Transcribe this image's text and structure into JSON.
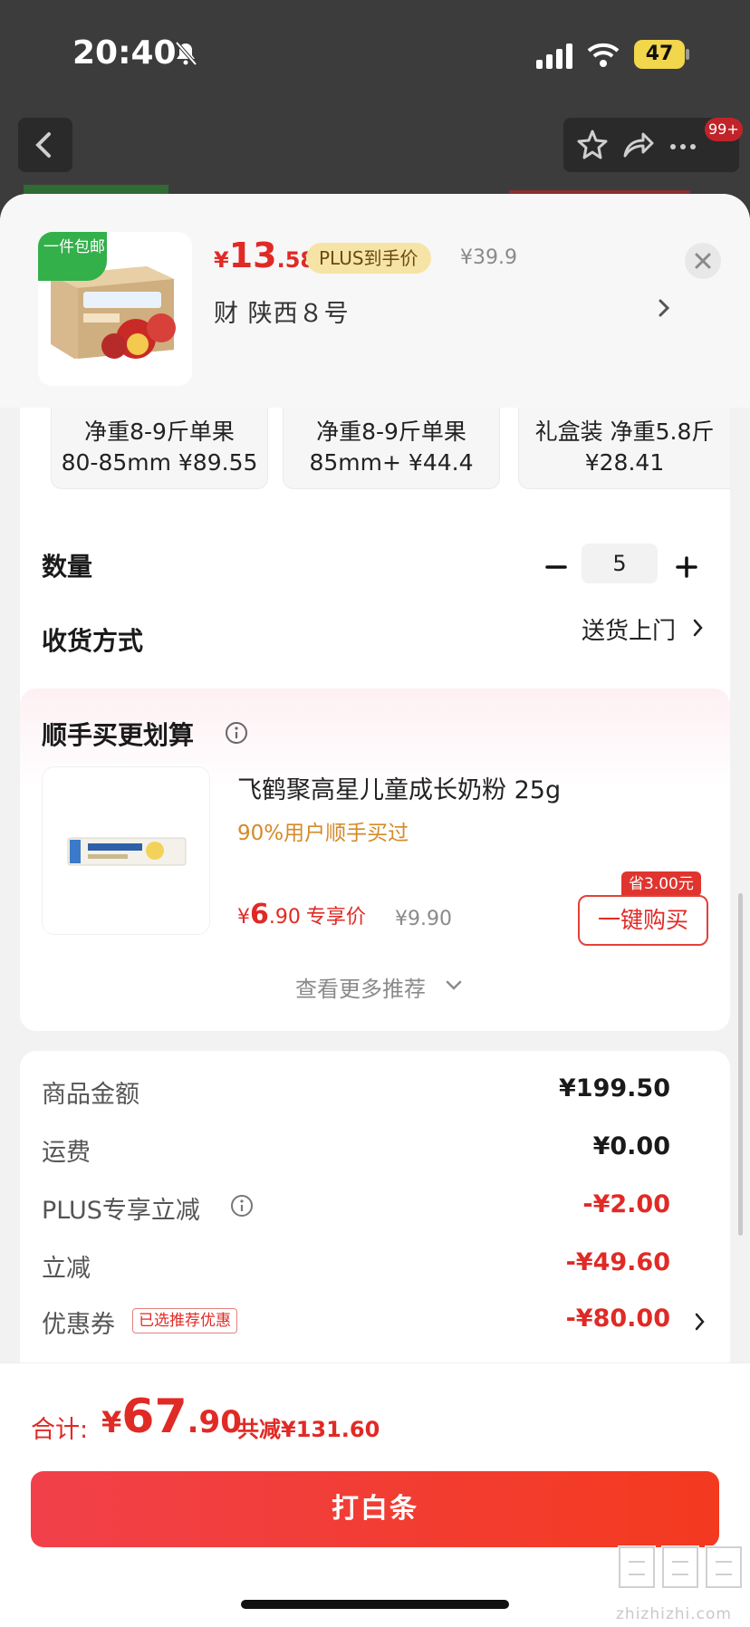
{
  "status_bar": {
    "time": "20:40",
    "battery": "47"
  },
  "background": {
    "notification_badge": "99+"
  },
  "header": {
    "shipping_tag": "一件包邮",
    "price_symbol": "¥",
    "price_int": "13",
    "price_dec": ".58",
    "plus_tag": "PLUS到手价",
    "original_price": "¥39.9",
    "selected_variant": "财  陕西８号"
  },
  "specs": [
    {
      "line1": "净重8-9斤单果",
      "line2": "80-85mm ¥89.55"
    },
    {
      "line1": "净重8-9斤单果",
      "line2": "85mm+ ¥44.4"
    },
    {
      "line1": "礼盒装 净重5.8斤",
      "line2": "¥28.41"
    }
  ],
  "quantity": {
    "label": "数量",
    "value": "5"
  },
  "delivery": {
    "label": "收货方式",
    "value": "送货上门"
  },
  "recommend": {
    "title": "顺手买更划算",
    "item_name": "飞鹤聚高星儿童成长奶粉 25g",
    "item_sub": "90%用户顺手买过",
    "price_symbol": "¥",
    "price_int": "6",
    "price_dec": ".90",
    "price_label": "专享价",
    "original_price": "¥9.90",
    "save_badge": "省3.00元",
    "buy_button": "一键购买",
    "more_link": "查看更多推荐"
  },
  "summary": {
    "rows": [
      {
        "label": "商品金额",
        "value": "¥199.50"
      },
      {
        "label": "运费",
        "value": "¥0.00"
      },
      {
        "label": "PLUS专享立减",
        "value": "-¥2.00"
      },
      {
        "label": "立减",
        "value": "-¥49.60"
      },
      {
        "label": "优惠券",
        "value": "-¥80.00"
      }
    ],
    "coupon_tag": "已选推荐优惠"
  },
  "footer": {
    "total_label": "合计:",
    "total_symbol": "¥",
    "total_int": "67",
    "total_dec": ".90",
    "total_save": "共减¥131.60",
    "pay_button": "打白条",
    "watermark": "zhizhizhi.com"
  },
  "colors": {
    "accent": "#e02a26",
    "plus_tag_bg": "#f6e4a6",
    "ship_tag": "#33b04a"
  }
}
